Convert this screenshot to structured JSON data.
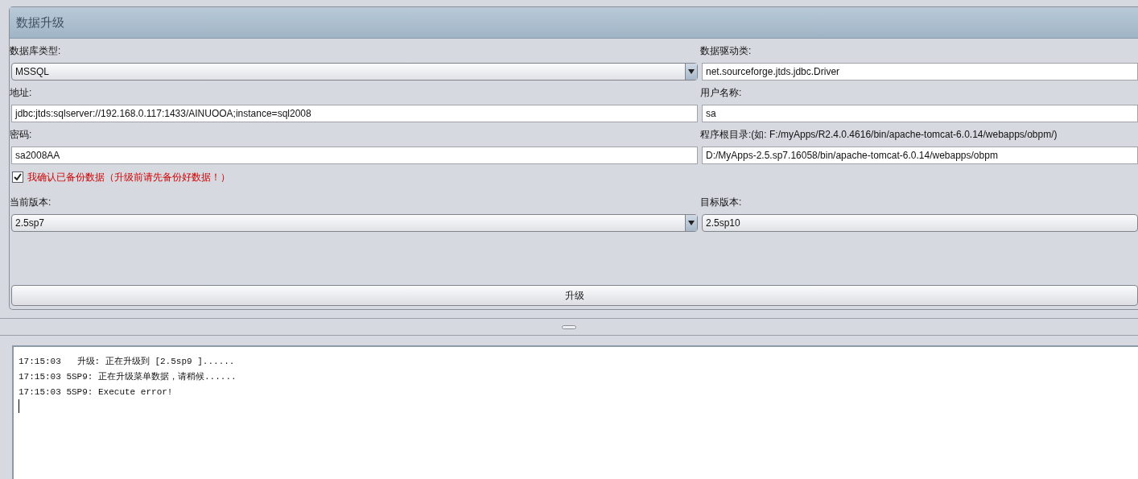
{
  "panel": {
    "title": "数据升级"
  },
  "fields": [
    {
      "label": "数据库类型:",
      "kind": "select",
      "value": "MSSQL",
      "arrow": true
    },
    {
      "label": "数据驱动类:",
      "kind": "input",
      "value": "net.sourceforge.jtds.jdbc.Driver"
    },
    {
      "label": "地址:",
      "kind": "input",
      "value": "jdbc:jtds:sqlserver://192.168.0.117:1433/AINUOOA;instance=sql2008"
    },
    {
      "label": "用户名称:",
      "kind": "input",
      "value": "sa"
    },
    {
      "label": "密码:",
      "kind": "input",
      "value": "sa2008AA"
    },
    {
      "label": "程序根目录:(如: F:/myApps/R2.4.0.4616/bin/apache-tomcat-6.0.14/webapps/obpm/)",
      "kind": "input",
      "value": "D:/MyApps-2.5.sp7.16058/bin/apache-tomcat-6.0.14/webapps/obpm"
    }
  ],
  "backup_confirm": {
    "label": "我确认已备份数据（升级前请先备份好数据！）",
    "checked": true
  },
  "versions": [
    {
      "label": "当前版本:",
      "kind": "select",
      "value": "2.5sp7",
      "arrow": true
    },
    {
      "label": "目标版本:",
      "kind": "select",
      "value": "2.5sp10",
      "arrow": false
    }
  ],
  "upgrade_button": "升级",
  "log": [
    "17:15:03   升级: 正在升级到 [2.5sp9 ]......",
    "17:15:03 5SP9: 正在升级菜单数据，请稍候......",
    "17:15:03 5SP9: Execute error!"
  ]
}
